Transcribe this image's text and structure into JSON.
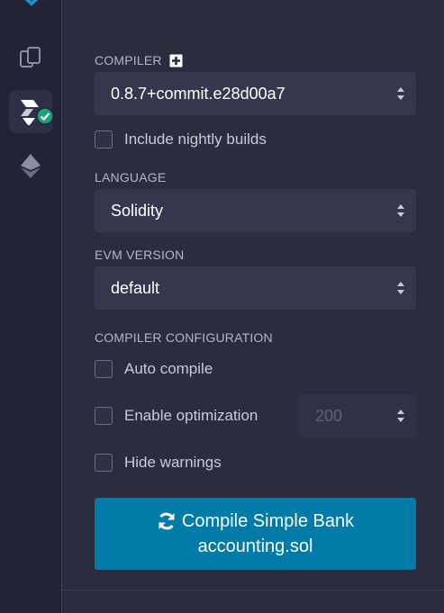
{
  "compiler": {
    "label": "COMPILER",
    "version": "0.8.7+commit.e28d00a7",
    "nightly_label": "Include nightly builds"
  },
  "language": {
    "label": "LANGUAGE",
    "value": "Solidity"
  },
  "evm": {
    "label": "EVM VERSION",
    "value": "default"
  },
  "config": {
    "label": "COMPILER CONFIGURATION",
    "auto_compile": "Auto compile",
    "optimization": "Enable optimization",
    "runs": "200",
    "hide_warnings": "Hide warnings"
  },
  "compile_button": {
    "line1": "Compile Simple Bank",
    "line2": "accounting.sol"
  },
  "colors": {
    "background": "#2a2c3f",
    "accent": "#007aa6",
    "success": "#1aa37a"
  },
  "icons": [
    "remix-logo-icon",
    "file-explorer-icon",
    "solidity-compiler-icon",
    "check-badge-icon",
    "deploy-ethereum-icon",
    "plus-box-icon",
    "sort-arrows-icon",
    "refresh-icon"
  ]
}
